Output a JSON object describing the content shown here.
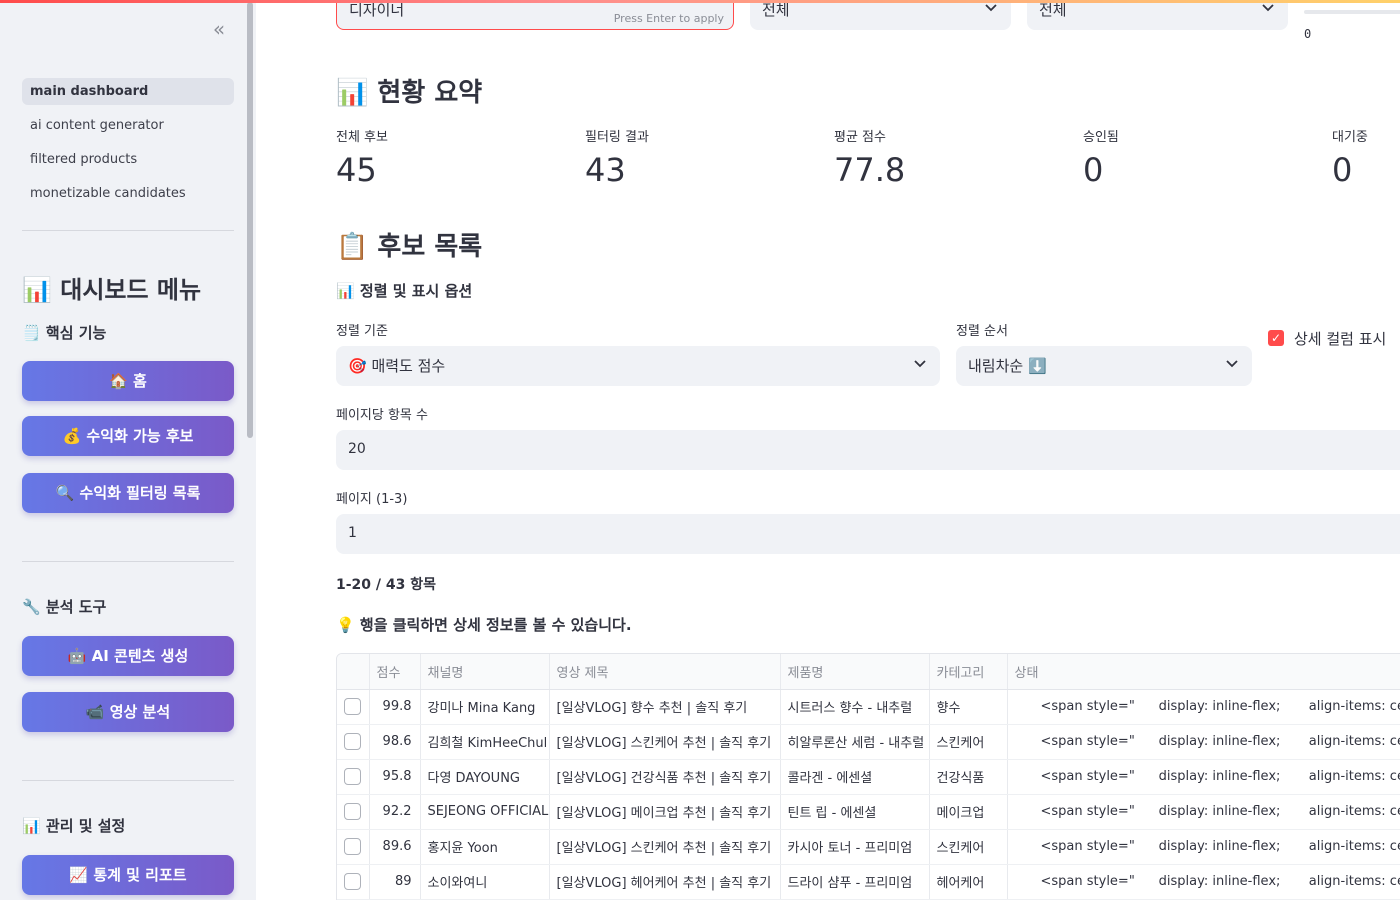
{
  "sidebar": {
    "collapse_glyph": "«",
    "nav": [
      {
        "label": "main dashboard",
        "active": true
      },
      {
        "label": "ai content generator",
        "active": false
      },
      {
        "label": "filtered products",
        "active": false
      },
      {
        "label": "monetizable candidates",
        "active": false
      }
    ],
    "menu_title": "📊 대시보드 메뉴",
    "sections": {
      "core": "🗒️ 핵심 기능",
      "analysis": "🔧 분석 도구",
      "manage": "📊 관리 및 설정"
    },
    "buttons": {
      "home": "🏠 홈",
      "monetizable": "💰 수익화 가능 후보",
      "filtered": "🔍 수익화 필터링 목록",
      "ai_content": "🤖 AI 콘텐츠 생성",
      "video_analysis": "📹 영상 분석",
      "stats": "📈 통계 및 리포트"
    }
  },
  "filters": {
    "search_value": "디자이너",
    "search_hint": "Press Enter to apply",
    "select1_value": "전체",
    "select2_value": "전체",
    "slider_value": "0"
  },
  "summary": {
    "title": "📊 현황 요약",
    "metrics": [
      {
        "label": "전체 후보",
        "value": "45"
      },
      {
        "label": "필터링 결과",
        "value": "43"
      },
      {
        "label": "평균 점수",
        "value": "77.8"
      },
      {
        "label": "승인됨",
        "value": "0"
      },
      {
        "label": "대기중",
        "value": "0"
      }
    ]
  },
  "candidates": {
    "title": "📋 후보 목록",
    "options_title": "📊 정렬 및 표시 옵션",
    "sort_by_label": "정렬 기준",
    "sort_by_value": "🎯 매력도 점수",
    "sort_order_label": "정렬 순서",
    "sort_order_value": "내림차순 ⬇️",
    "detail_columns_label": "상세 컬럼 표시",
    "detail_columns_checked": true,
    "per_page_label": "페이지당 항목 수",
    "per_page_value": "20",
    "page_label": "페이지 (1-3)",
    "page_value": "1",
    "count_text": "1-20 / 43 항목",
    "tip": "💡 행을 클릭하면 상세 정보를 볼 수 있습니다."
  },
  "table": {
    "columns": [
      "점수",
      "채널명",
      "영상 제목",
      "제품명",
      "카테고리",
      "상태"
    ],
    "rows": [
      {
        "score": "99.8",
        "channel": "강미나 Mina Kang",
        "title": "[일상VLOG] 향수 추천 | 솔직 후기",
        "product": "시트러스 향수 - 내추럴",
        "category": "향수",
        "status": [
          "<span style=\"",
          "display: inline-flex;",
          "align-items: center;"
        ]
      },
      {
        "score": "98.6",
        "channel": "김희철 KimHeeChul",
        "title": "[일상VLOG] 스킨케어 추천 | 솔직 후기",
        "product": "히알루론산 세럼 - 내추럴",
        "category": "스킨케어",
        "status": [
          "<span style=\"",
          "display: inline-flex;",
          "align-items: center;"
        ]
      },
      {
        "score": "95.8",
        "channel": "다영 DAYOUNG",
        "title": "[일상VLOG] 건강식품 추천 | 솔직 후기",
        "product": "콜라겐 - 에센셜",
        "category": "건강식품",
        "status": [
          "<span style=\"",
          "display: inline-flex;",
          "align-items: center;"
        ]
      },
      {
        "score": "92.2",
        "channel": "SEJEONG OFFICIAL",
        "title": "[일상VLOG] 메이크업 추천 | 솔직 후기",
        "product": "틴트 립 - 에센셜",
        "category": "메이크업",
        "status": [
          "<span style=\"",
          "display: inline-flex;",
          "align-items: center;"
        ]
      },
      {
        "score": "89.6",
        "channel": "홍지윤 Yoon",
        "title": "[일상VLOG] 스킨케어 추천 | 솔직 후기",
        "product": "카시아 토너 - 프리미엄",
        "category": "스킨케어",
        "status": [
          "<span style=\"",
          "display: inline-flex;",
          "align-items: center;"
        ]
      },
      {
        "score": "89",
        "channel": "소이와여니",
        "title": "[일상VLOG] 헤어케어 추천 | 솔직 후기",
        "product": "드라이 샴푸 - 프리미엄",
        "category": "헤어케어",
        "status": [
          "<span style=\"",
          "display: inline-flex;",
          "align-items: center;"
        ]
      }
    ]
  },
  "colors": {
    "accent": "#ff4b4b",
    "button_gradient_start": "#6678e6",
    "button_gradient_end": "#7a5ac8",
    "sidebar_bg": "#f0f2f6"
  }
}
